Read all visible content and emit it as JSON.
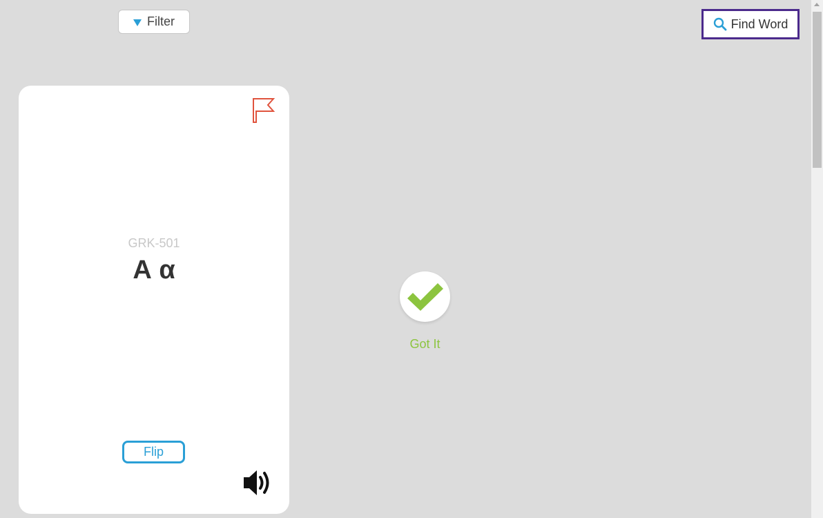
{
  "toolbar": {
    "filter_label": "Filter",
    "filter_icon": "triangle-down-icon",
    "find_word_label": "Find Word",
    "find_word_icon": "search-icon"
  },
  "card": {
    "code": "GRK-501",
    "word": "Α α",
    "flip_label": "Flip",
    "flag_icon": "flag-icon",
    "sound_icon": "speaker-icon"
  },
  "got_it": {
    "label": "Got It",
    "icon": "checkmark-icon"
  },
  "colors": {
    "accent_blue": "#2a9fd6",
    "got_it_green": "#8cc43f",
    "flag_red": "#e0533d",
    "focus_purple": "#4b2a8c",
    "background": "#dcdcdc"
  }
}
